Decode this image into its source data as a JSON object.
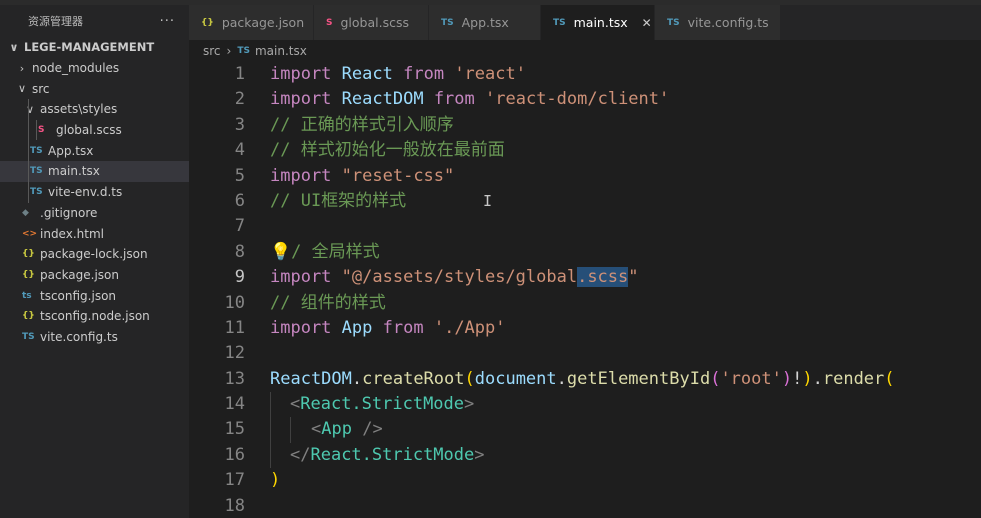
{
  "explorer": {
    "title": "资源管理器",
    "more": "···",
    "tree": [
      {
        "label": "LEGE-MANAGEMENT",
        "chev": "∨",
        "icon": "",
        "type": "root"
      },
      {
        "label": "node_modules",
        "chev": "›",
        "icon": "",
        "type": "folder"
      },
      {
        "label": "src",
        "chev": "∨",
        "icon": "",
        "type": "folder"
      },
      {
        "label": "assets\\styles",
        "chev": "∨",
        "icon": "",
        "type": "folder"
      },
      {
        "label": "global.scss",
        "chev": "",
        "icon": "S",
        "type": "scss"
      },
      {
        "label": "App.tsx",
        "chev": "",
        "icon": "TS",
        "type": "ts"
      },
      {
        "label": "main.tsx",
        "chev": "",
        "icon": "TS",
        "type": "ts"
      },
      {
        "label": "vite-env.d.ts",
        "chev": "",
        "icon": "TS",
        "type": "ts"
      },
      {
        "label": ".gitignore",
        "chev": "",
        "icon": "◆",
        "type": "git"
      },
      {
        "label": "index.html",
        "chev": "",
        "icon": "<>",
        "type": "html"
      },
      {
        "label": "package-lock.json",
        "chev": "",
        "icon": "{}",
        "type": "json"
      },
      {
        "label": "package.json",
        "chev": "",
        "icon": "{}",
        "type": "json"
      },
      {
        "label": "tsconfig.json",
        "chev": "",
        "icon": "ts",
        "type": "tsconfig"
      },
      {
        "label": "tsconfig.node.json",
        "chev": "",
        "icon": "{}",
        "type": "json"
      },
      {
        "label": "vite.config.ts",
        "chev": "",
        "icon": "TS",
        "type": "ts"
      }
    ],
    "selected": "main.tsx"
  },
  "tabs": [
    {
      "icon": "{}",
      "label": "package.json",
      "type": "json"
    },
    {
      "icon": "S",
      "label": "global.scss",
      "type": "scss"
    },
    {
      "icon": "TS",
      "label": "App.tsx",
      "type": "ts"
    },
    {
      "icon": "TS",
      "label": "main.tsx",
      "type": "ts",
      "active": true,
      "close": "✕"
    },
    {
      "icon": "TS",
      "label": "vite.config.ts",
      "type": "ts"
    }
  ],
  "breadcrumb": {
    "folder": "src",
    "sep": "›",
    "file_icon": "TS",
    "file": "main.tsx"
  },
  "editor": {
    "line_numbers": [
      "1",
      "2",
      "3",
      "4",
      "5",
      "6",
      "7",
      "8",
      "9",
      "10",
      "11",
      "12",
      "13",
      "14",
      "15",
      "16",
      "17",
      "18"
    ],
    "current_line": "9",
    "tokens": {
      "import": "import",
      "from": "from",
      "react": "React",
      "react_str": "'react'",
      "reactdom": "ReactDOM",
      "reactdom_str": "'react-dom/client'",
      "cmt3": "// 正确的样式引入顺序",
      "cmt4": "// 样式初始化一般放在最前面",
      "reset_css": "\"reset-css\"",
      "cmt6": "// UI框架的样式",
      "cmt8_slash": "/",
      "cmt8_rest": "/ 全局样式",
      "global_pre": "\"@/assets/styles/global",
      "global_sel": ".scss",
      "global_post": "\"",
      "cmt10": "// 组件的样式",
      "app": "App",
      "app_str": "'./App'",
      "l13_reactdom": "ReactDOM",
      "l13_dot1": ".",
      "l13_createroot": "createRoot",
      "l13_paren1": "(",
      "l13_document": "document",
      "l13_dot2": ".",
      "l13_getel": "getElementById",
      "l13_paren2": "(",
      "l13_root": "'root'",
      "l13_paren3": ")",
      "l13_bang": "!",
      "l13_paren4": ")",
      "l13_dot3": ".",
      "l13_render": "render",
      "l13_paren5": "(",
      "l14_lt": "<",
      "l14_tag": "React.StrictMode",
      "l14_gt": ">",
      "l15_lt": "<",
      "l15_tag": "App",
      "l15_end": " />",
      "l16_lt": "</",
      "l16_tag": "React.StrictMode",
      "l16_gt": ">",
      "l17": ")"
    }
  },
  "cursor": "I"
}
